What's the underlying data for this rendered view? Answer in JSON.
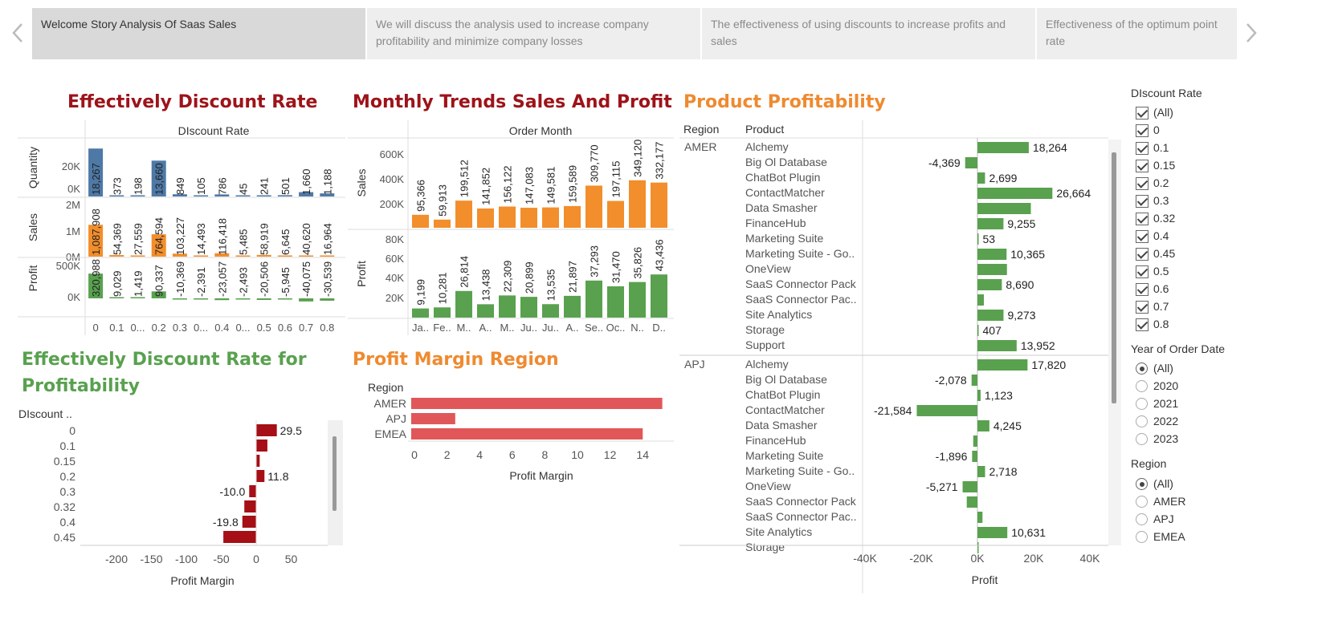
{
  "story": {
    "tabs": [
      {
        "label": "Welcome Story Analysis Of Saas Sales",
        "active": true
      },
      {
        "label": "We will discuss the analysis used to increase company profitability and minimize company losses",
        "active": false
      },
      {
        "label": "The effectiveness of using discounts to increase profits and sales",
        "active": false
      },
      {
        "label": "Effectiveness of the optimum point rate",
        "active": false
      }
    ],
    "prev_icon": "chevron-left-icon",
    "next_icon": "chevron-right-icon"
  },
  "titles": {
    "discount_rate": "Effectively Discount Rate",
    "monthly": "Monthly Trends Sales And Profit",
    "product": "Product Profitability",
    "profitability": "Effectively Discount Rate for Profitability",
    "region_margin": "Profit Margin Region"
  },
  "colors": {
    "title_red": "#9d1319",
    "title_orange": "#ef8a30",
    "title_green": "#59a14f",
    "quantity_blue": "#4e79a7",
    "sales_orange": "#f28e2b",
    "profit_green": "#59a14f",
    "margin_red": "#e15759",
    "dark_red": "#a50f15"
  },
  "chart_data": [
    {
      "type": "bar",
      "header": "DIscount Rate",
      "categories": [
        "0",
        "0.1",
        "0...",
        "0.2",
        "0.3",
        "0...",
        "0.4",
        "0...",
        "0.5",
        "0.6",
        "0.7",
        "0.8"
      ],
      "series": [
        {
          "name": "Quantity",
          "values": [
            18267,
            373,
            198,
            13660,
            849,
            105,
            786,
            45,
            241,
            501,
            1660,
            1188
          ],
          "labels": [
            "18,267",
            "373",
            "198",
            "13,660",
            "849",
            "105",
            "786",
            "45",
            "241",
            "501",
            "1,660",
            "1,188"
          ],
          "ticks": [
            "20K",
            "0K"
          ]
        },
        {
          "name": "Sales",
          "values": [
            1087908,
            54369,
            27559,
            764594,
            103227,
            14493,
            116418,
            5485,
            58919,
            6645,
            40620,
            16964
          ],
          "labels": [
            "1,087,908",
            "54,369",
            "27,559",
            "764,594",
            "103,227",
            "14,493",
            "116,418",
            "5,485",
            "58,919",
            "6,645",
            "40,620",
            "16,964"
          ],
          "ticks": [
            "2M",
            "1M",
            "0M"
          ]
        },
        {
          "name": "Profit",
          "values": [
            320988,
            9029,
            1419,
            90337,
            -10369,
            -2391,
            -23057,
            -2493,
            -20506,
            -5945,
            -40075,
            -30539
          ],
          "labels": [
            "320,988",
            "9,029",
            "1,419",
            "90,337",
            "-10,369",
            "-2,391",
            "-23,057",
            "-2,493",
            "-20,506",
            "-5,945",
            "-40,075",
            "-30,539"
          ],
          "ticks": [
            "500K",
            "0K"
          ]
        }
      ]
    },
    {
      "type": "bar",
      "header": "Order Month",
      "categories": [
        "Ja..",
        "Fe..",
        "M..",
        "A..",
        "M..",
        "Ju..",
        "Ju..",
        "A..",
        "Se..",
        "Oc..",
        "N..",
        "D.."
      ],
      "series": [
        {
          "name": "Sales",
          "values": [
            95366,
            59913,
            199512,
            141852,
            156122,
            147083,
            149581,
            159589,
            309770,
            197115,
            349120,
            332177
          ],
          "labels": [
            "95,366",
            "59,913",
            "199,512",
            "141,852",
            "156,122",
            "147,083",
            "149,581",
            "159,589",
            "309,770",
            "197,115",
            "349,120",
            "332,177"
          ],
          "ticks": [
            "600K",
            "400K",
            "200K"
          ],
          "ylim": [
            0,
            660000
          ]
        },
        {
          "name": "Profit",
          "values": [
            9199,
            10281,
            26814,
            13438,
            22309,
            20899,
            13535,
            21897,
            37293,
            31470,
            35826,
            43436
          ],
          "labels": [
            "9,199",
            "10,281",
            "26,814",
            "13,438",
            "22,309",
            "20,899",
            "13,535",
            "21,897",
            "37,293",
            "31,470",
            "35,826",
            "43,436"
          ],
          "ticks": [
            "80K",
            "60K",
            "40K",
            "20K"
          ],
          "ylim": [
            0,
            88000
          ]
        }
      ]
    },
    {
      "type": "bar",
      "orientation": "horizontal",
      "header_region": "Region",
      "header_product": "Product",
      "xlabel": "Profit",
      "xticks": [
        "-40K",
        "-20K",
        "0K",
        "20K",
        "40K"
      ],
      "xlim": [
        -45000,
        45000
      ],
      "groups": [
        {
          "region": "AMER",
          "rows": [
            {
              "product": "Alchemy",
              "value": 18264,
              "label": "18,264"
            },
            {
              "product": "Big Ol Database",
              "value": -4369,
              "label": "-4,369"
            },
            {
              "product": "ChatBot Plugin",
              "value": 2699,
              "label": "2,699"
            },
            {
              "product": "ContactMatcher",
              "value": 26664,
              "label": "26,664"
            },
            {
              "product": "Data Smasher",
              "value": 19000,
              "label": ""
            },
            {
              "product": "FinanceHub",
              "value": 9255,
              "label": "9,255"
            },
            {
              "product": "Marketing Suite",
              "value": 53,
              "label": "53"
            },
            {
              "product": "Marketing Suite - Go..",
              "value": 10365,
              "label": "10,365"
            },
            {
              "product": "OneView",
              "value": 10500,
              "label": ""
            },
            {
              "product": "SaaS Connector Pack",
              "value": 8690,
              "label": "8,690"
            },
            {
              "product": "SaaS Connector Pac..",
              "value": 2300,
              "label": ""
            },
            {
              "product": "Site Analytics",
              "value": 9273,
              "label": "9,273"
            },
            {
              "product": "Storage",
              "value": 407,
              "label": "407"
            },
            {
              "product": "Support",
              "value": 13952,
              "label": "13,952"
            }
          ]
        },
        {
          "region": "APJ",
          "rows": [
            {
              "product": "Alchemy",
              "value": 17820,
              "label": "17,820"
            },
            {
              "product": "Big Ol Database",
              "value": -2078,
              "label": "-2,078"
            },
            {
              "product": "ChatBot Plugin",
              "value": 1123,
              "label": "1,123"
            },
            {
              "product": "ContactMatcher",
              "value": -21584,
              "label": "-21,584"
            },
            {
              "product": "Data Smasher",
              "value": 4245,
              "label": "4,245"
            },
            {
              "product": "FinanceHub",
              "value": -1500,
              "label": ""
            },
            {
              "product": "Marketing Suite",
              "value": -1896,
              "label": "-1,896"
            },
            {
              "product": "Marketing Suite - Go..",
              "value": 2718,
              "label": "2,718"
            },
            {
              "product": "OneView",
              "value": -5271,
              "label": "-5,271"
            },
            {
              "product": "SaaS Connector Pack",
              "value": -3800,
              "label": ""
            },
            {
              "product": "SaaS Connector Pac..",
              "value": 1800,
              "label": ""
            },
            {
              "product": "Site Analytics",
              "value": 10631,
              "label": "10,631"
            },
            {
              "product": "Storage",
              "value": 300,
              "label": ""
            }
          ]
        }
      ]
    },
    {
      "type": "bar",
      "orientation": "horizontal",
      "header": "DIscount ..",
      "xlabel": "Profit Margin",
      "categories": [
        "0",
        "0.1",
        "0.15",
        "0.2",
        "0.3",
        "0.32",
        "0.4",
        "0.45"
      ],
      "values": [
        29.5,
        16,
        5,
        11.8,
        -10.0,
        -17,
        -19.8,
        -47
      ],
      "labels": [
        "29.5",
        "",
        "",
        "11.8",
        "-10.0",
        "",
        "-19.8",
        ""
      ],
      "xticks": [
        "-200",
        "-150",
        "-100",
        "-50",
        "0",
        "50"
      ],
      "xlim": [
        -225,
        112
      ]
    },
    {
      "type": "bar",
      "orientation": "horizontal",
      "header": "Region",
      "xlabel": "Profit Margin",
      "categories": [
        "AMER",
        "APJ",
        "EMEA"
      ],
      "values": [
        15.4,
        2.7,
        14.2
      ],
      "xticks": [
        "0",
        "2",
        "4",
        "6",
        "8",
        "10",
        "12",
        "14"
      ],
      "xlim": [
        0,
        16
      ]
    }
  ],
  "filters": {
    "discount": {
      "title": "DIscount Rate",
      "options": [
        "(All)",
        "0",
        "0.1",
        "0.15",
        "0.2",
        "0.3",
        "0.32",
        "0.4",
        "0.45",
        "0.5",
        "0.6",
        "0.7",
        "0.8"
      ]
    },
    "year": {
      "title": "Year of Order Date",
      "options": [
        "(All)",
        "2020",
        "2021",
        "2022",
        "2023"
      ],
      "selected": "(All)"
    },
    "region": {
      "title": "Region",
      "options": [
        "(All)",
        "AMER",
        "APJ",
        "EMEA"
      ],
      "selected": "(All)"
    }
  }
}
